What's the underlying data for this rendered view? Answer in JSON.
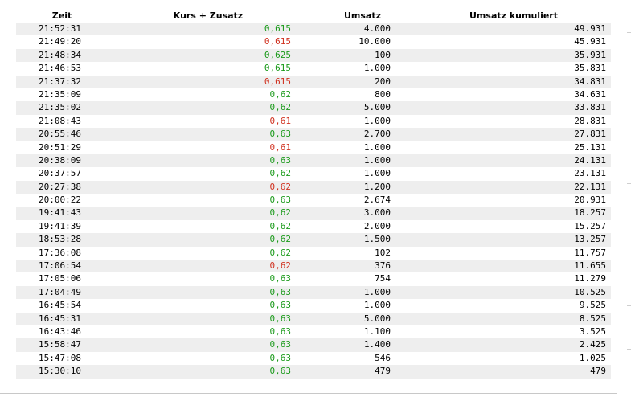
{
  "headers": {
    "zeit": "Zeit",
    "kurs": "Kurs + Zusatz",
    "umsatz": "Umsatz",
    "kumuliert": "Umsatz kumuliert"
  },
  "colors": {
    "up": "#1a9a1a",
    "down": "#d0311f",
    "stripe": "#eeeeee"
  },
  "rows": [
    {
      "zeit": "21:52:31",
      "kurs": "0,615",
      "dir": "up",
      "umsatz": "4.000",
      "kumuliert": "49.931"
    },
    {
      "zeit": "21:49:20",
      "kurs": "0,615",
      "dir": "down",
      "umsatz": "10.000",
      "kumuliert": "45.931"
    },
    {
      "zeit": "21:48:34",
      "kurs": "0,625",
      "dir": "up",
      "umsatz": "100",
      "kumuliert": "35.931"
    },
    {
      "zeit": "21:46:53",
      "kurs": "0,615",
      "dir": "up",
      "umsatz": "1.000",
      "kumuliert": "35.831"
    },
    {
      "zeit": "21:37:32",
      "kurs": "0,615",
      "dir": "down",
      "umsatz": "200",
      "kumuliert": "34.831"
    },
    {
      "zeit": "21:35:09",
      "kurs": "0,62",
      "dir": "up",
      "umsatz": "800",
      "kumuliert": "34.631"
    },
    {
      "zeit": "21:35:02",
      "kurs": "0,62",
      "dir": "up",
      "umsatz": "5.000",
      "kumuliert": "33.831"
    },
    {
      "zeit": "21:08:43",
      "kurs": "0,61",
      "dir": "down",
      "umsatz": "1.000",
      "kumuliert": "28.831"
    },
    {
      "zeit": "20:55:46",
      "kurs": "0,63",
      "dir": "up",
      "umsatz": "2.700",
      "kumuliert": "27.831"
    },
    {
      "zeit": "20:51:29",
      "kurs": "0,61",
      "dir": "down",
      "umsatz": "1.000",
      "kumuliert": "25.131"
    },
    {
      "zeit": "20:38:09",
      "kurs": "0,63",
      "dir": "up",
      "umsatz": "1.000",
      "kumuliert": "24.131"
    },
    {
      "zeit": "20:37:57",
      "kurs": "0,62",
      "dir": "up",
      "umsatz": "1.000",
      "kumuliert": "23.131"
    },
    {
      "zeit": "20:27:38",
      "kurs": "0,62",
      "dir": "down",
      "umsatz": "1.200",
      "kumuliert": "22.131"
    },
    {
      "zeit": "20:00:22",
      "kurs": "0,63",
      "dir": "up",
      "umsatz": "2.674",
      "kumuliert": "20.931"
    },
    {
      "zeit": "19:41:43",
      "kurs": "0,62",
      "dir": "up",
      "umsatz": "3.000",
      "kumuliert": "18.257"
    },
    {
      "zeit": "19:41:39",
      "kurs": "0,62",
      "dir": "up",
      "umsatz": "2.000",
      "kumuliert": "15.257"
    },
    {
      "zeit": "18:53:28",
      "kurs": "0,62",
      "dir": "up",
      "umsatz": "1.500",
      "kumuliert": "13.257"
    },
    {
      "zeit": "17:36:08",
      "kurs": "0,62",
      "dir": "up",
      "umsatz": "102",
      "kumuliert": "11.757"
    },
    {
      "zeit": "17:06:54",
      "kurs": "0,62",
      "dir": "down",
      "umsatz": "376",
      "kumuliert": "11.655"
    },
    {
      "zeit": "17:05:06",
      "kurs": "0,63",
      "dir": "up",
      "umsatz": "754",
      "kumuliert": "11.279"
    },
    {
      "zeit": "17:04:49",
      "kurs": "0,63",
      "dir": "up",
      "umsatz": "1.000",
      "kumuliert": "10.525"
    },
    {
      "zeit": "16:45:54",
      "kurs": "0,63",
      "dir": "up",
      "umsatz": "1.000",
      "kumuliert": "9.525"
    },
    {
      "zeit": "16:45:31",
      "kurs": "0,63",
      "dir": "up",
      "umsatz": "5.000",
      "kumuliert": "8.525"
    },
    {
      "zeit": "16:43:46",
      "kurs": "0,63",
      "dir": "up",
      "umsatz": "1.100",
      "kumuliert": "3.525"
    },
    {
      "zeit": "15:58:47",
      "kurs": "0,63",
      "dir": "up",
      "umsatz": "1.400",
      "kumuliert": "2.425"
    },
    {
      "zeit": "15:47:08",
      "kurs": "0,63",
      "dir": "up",
      "umsatz": "546",
      "kumuliert": "1.025"
    },
    {
      "zeit": "15:30:10",
      "kurs": "0,63",
      "dir": "up",
      "umsatz": "479",
      "kumuliert": "479"
    }
  ]
}
